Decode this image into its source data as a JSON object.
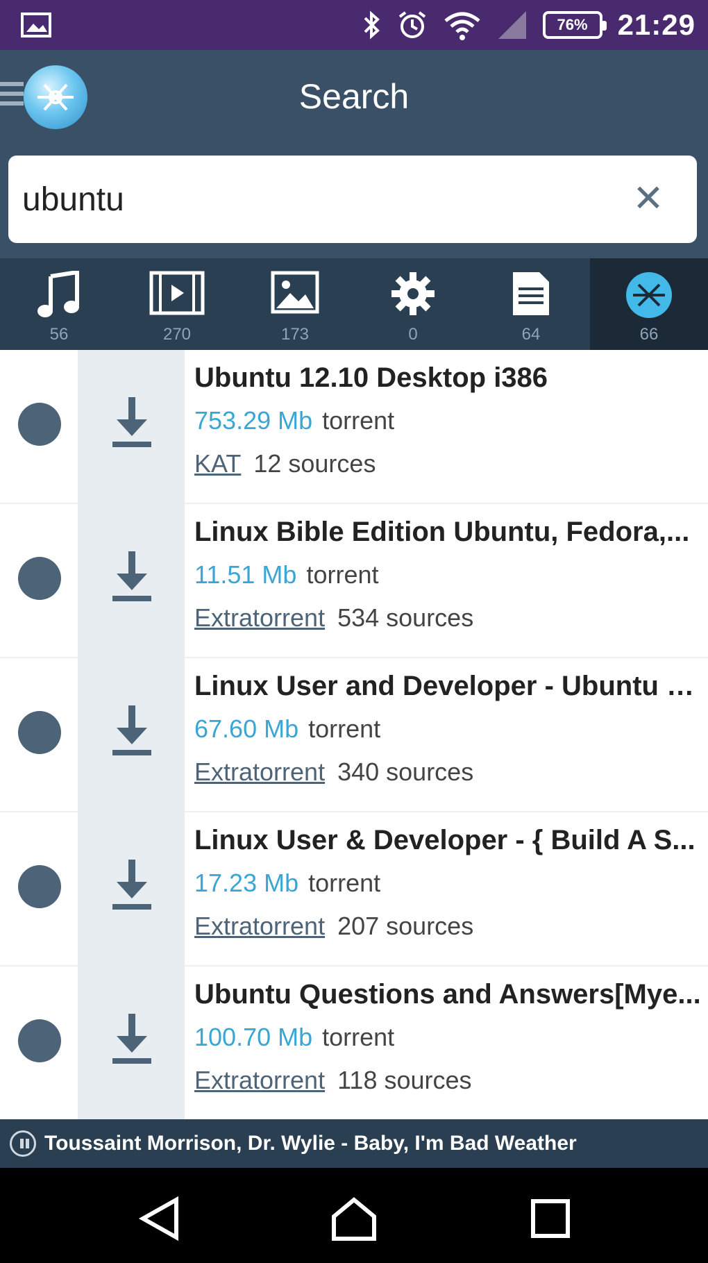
{
  "status_bar": {
    "time": "21:29",
    "battery": "76%",
    "icons": [
      "image-icon",
      "bluetooth-icon",
      "alarm-icon",
      "wifi-icon",
      "signal-icon",
      "battery-icon"
    ]
  },
  "app_bar": {
    "title": "Search",
    "icons": [
      "menu-icon",
      "app-logo-icon"
    ]
  },
  "search": {
    "value": "ubuntu",
    "clear_label": "✕"
  },
  "tabs": [
    {
      "icon": "music-icon",
      "count": "56"
    },
    {
      "icon": "video-icon",
      "count": "270"
    },
    {
      "icon": "image-icon",
      "count": "173"
    },
    {
      "icon": "gear-icon",
      "count": "0"
    },
    {
      "icon": "document-icon",
      "count": "64"
    },
    {
      "icon": "torrent-icon",
      "count": "66",
      "active": true
    }
  ],
  "results": [
    {
      "name": "Ubuntu 12.10 Desktop i386",
      "size": "753.29 Mb",
      "type": "torrent",
      "site": "KAT",
      "sources": "12 sources"
    },
    {
      "name": "Linux Bible Edition Ubuntu, Fedora,...",
      "size": "11.51 Mb",
      "type": "torrent",
      "site": "Extratorrent",
      "sources": "534 sources"
    },
    {
      "name": "Linux User and Developer - Ubuntu 1...",
      "size": "67.60 Mb",
      "type": "torrent",
      "site": "Extratorrent",
      "sources": "340 sources"
    },
    {
      "name": "Linux User & Developer - { Build A S...",
      "size": "17.23 Mb",
      "type": "torrent",
      "site": "Extratorrent",
      "sources": "207 sources"
    },
    {
      "name": "Ubuntu Questions and Answers[Mye...",
      "size": "100.70 Mb",
      "type": "torrent",
      "site": "Extratorrent",
      "sources": "118 sources"
    }
  ],
  "player": {
    "track": "Toussaint Morrison, Dr. Wylie - Baby, I'm Bad Weather"
  },
  "colors": {
    "status_bar": "#4a2a6e",
    "app_bar": "#395067",
    "tabs_bar": "#2a3f52",
    "accent_size": "#39a6d6"
  }
}
